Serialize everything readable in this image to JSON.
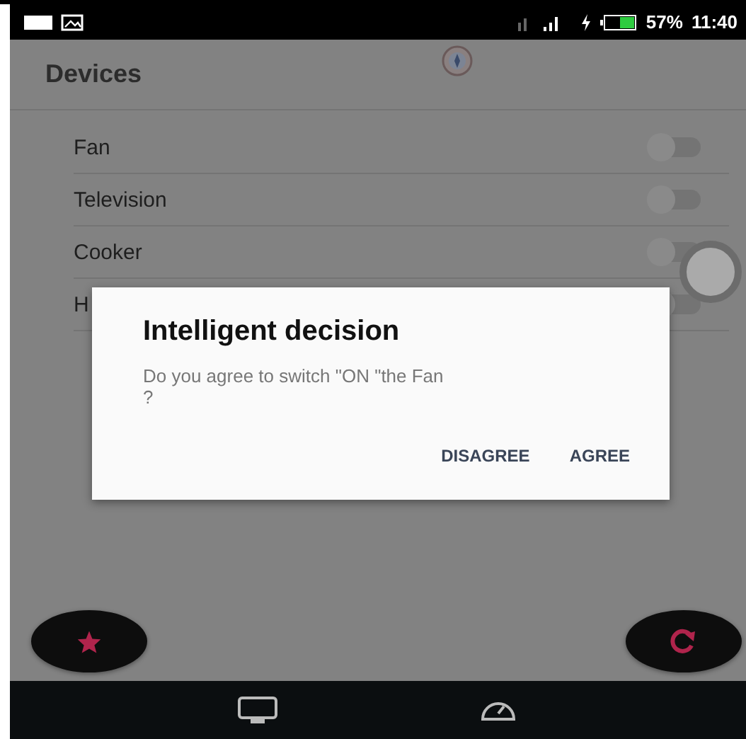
{
  "status_bar": {
    "battery": "57%",
    "time": "11:40"
  },
  "app_bar": {
    "title": "Devices"
  },
  "devices": [
    {
      "name": "Fan",
      "on": false
    },
    {
      "name": "Television",
      "on": false
    },
    {
      "name": "Cooker",
      "on": false
    },
    {
      "name": "H",
      "on": false
    }
  ],
  "dialog": {
    "title": "Intelligent decision",
    "message": "Do you agree to switch \"ON \"the Fan ?",
    "buttons": [
      "DISAGREE",
      "AGREE"
    ]
  }
}
